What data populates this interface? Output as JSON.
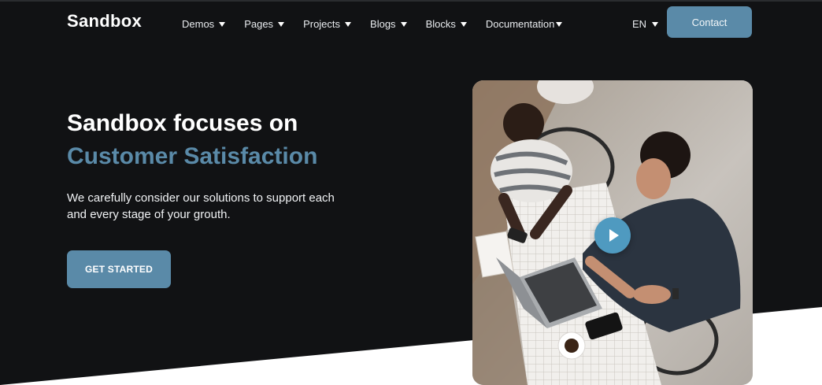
{
  "brand": {
    "logo_text": "Sandbox"
  },
  "nav": {
    "items": [
      {
        "label": "Demos"
      },
      {
        "label": "Pages"
      },
      {
        "label": "Projects"
      },
      {
        "label": "Blogs"
      },
      {
        "label": "Blocks"
      },
      {
        "label": "Documentation"
      }
    ],
    "language": "EN",
    "contact_label": "Contact"
  },
  "hero": {
    "title_line1": "Sandbox focuses on",
    "title_line2": "Customer Satisfaction",
    "description": "We carefully consider our solutions to support each and every stage of your grouth.",
    "cta_label": "GET STARTED"
  },
  "colors": {
    "background": "#111214",
    "accent": "#5a8aa8",
    "play_button": "#4f9ac0"
  },
  "icons": {
    "dropdown": "caret-down-icon",
    "play": "play-icon"
  }
}
